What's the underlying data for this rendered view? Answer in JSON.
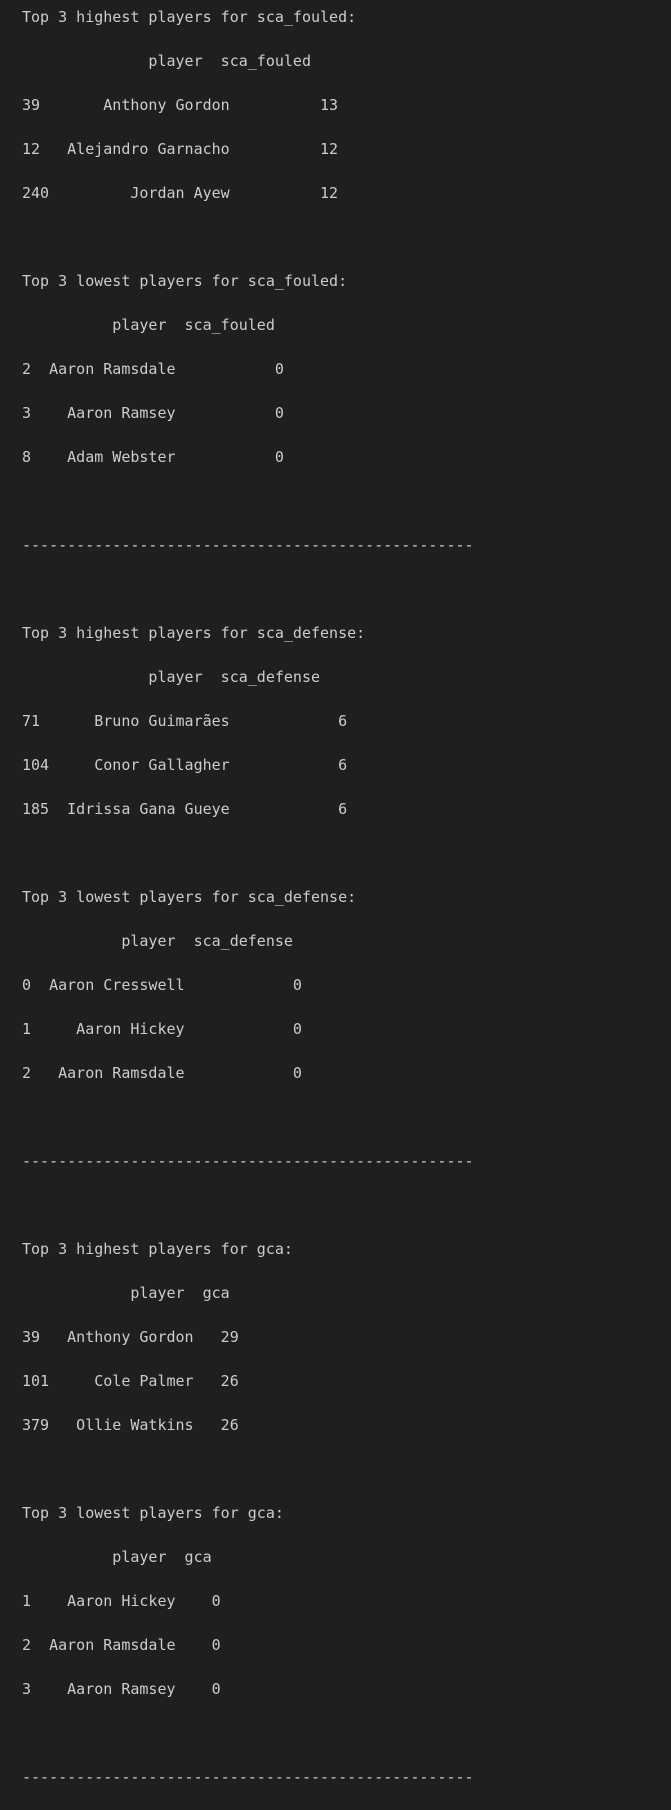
{
  "terminal": {
    "lines": [
      "Top 3 highest players for sca_fouled:",
      "              player  sca_fouled",
      "39       Anthony Gordon          13",
      "12   Alejandro Garnacho          12",
      "240         Jordan Ayew          12",
      "",
      "Top 3 lowest players for sca_fouled:",
      "          player  sca_fouled",
      "2  Aaron Ramsdale           0",
      "3    Aaron Ramsey           0",
      "8    Adam Webster           0",
      "",
      "--------------------------------------------------",
      "",
      "Top 3 highest players for sca_defense:",
      "              player  sca_defense",
      "71      Bruno Guimarães            6",
      "104     Conor Gallagher            6",
      "185  Idrissa Gana Gueye            6",
      "",
      "Top 3 lowest players for sca_defense:",
      "           player  sca_defense",
      "0  Aaron Cresswell            0",
      "1     Aaron Hickey            0",
      "2   Aaron Ramsdale            0",
      "",
      "--------------------------------------------------",
      "",
      "Top 3 highest players for gca:",
      "            player  gca",
      "39   Anthony Gordon   29",
      "101     Cole Palmer   26",
      "379   Ollie Watkins   26",
      "",
      "Top 3 lowest players for gca:",
      "          player  gca",
      "1    Aaron Hickey    0",
      "2  Aaron Ramsdale    0",
      "3    Aaron Ramsey    0",
      "",
      "--------------------------------------------------"
    ]
  }
}
